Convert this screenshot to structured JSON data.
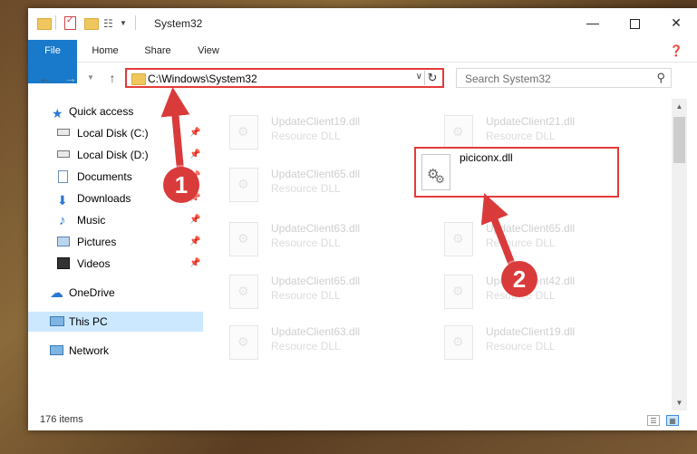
{
  "window": {
    "title": "System32"
  },
  "ribbon": {
    "tabs": [
      "File",
      "Home",
      "Share",
      "View"
    ]
  },
  "address": {
    "path": "C:\\Windows\\System32"
  },
  "search": {
    "placeholder": "Search System32"
  },
  "nav": {
    "quick_access": "Quick access",
    "items": [
      {
        "label": "Local Disk (C:)",
        "icon": "drive-icon",
        "pinned": true
      },
      {
        "label": "Local Disk (D:)",
        "icon": "drive-icon",
        "pinned": true
      },
      {
        "label": "Documents",
        "icon": "documents-icon",
        "pinned": true
      },
      {
        "label": "Downloads",
        "icon": "downloads-icon",
        "pinned": true
      },
      {
        "label": "Music",
        "icon": "music-icon",
        "pinned": true
      },
      {
        "label": "Pictures",
        "icon": "pictures-icon",
        "pinned": true
      },
      {
        "label": "Videos",
        "icon": "videos-icon",
        "pinned": true
      }
    ],
    "onedrive": "OneDrive",
    "this_pc": "This PC",
    "network": "Network"
  },
  "files": {
    "left_column": [
      {
        "name": "UpdateClient19.dll",
        "type": "Resource DLL"
      },
      {
        "name": "UpdateClient65.dll",
        "type": "Resource DLL"
      },
      {
        "name": "UpdateClient63.dll",
        "type": "Resource DLL"
      },
      {
        "name": "UpdateClient65.dll",
        "type": "Resource DLL"
      },
      {
        "name": "UpdateClient63.dll",
        "type": "Resource DLL"
      }
    ],
    "right_column": [
      {
        "name": "UpdateClient21.dll",
        "type": "Resource DLL"
      },
      {
        "name": "UpdateClient65.dll",
        "type": "Resource DLL"
      },
      {
        "name": "UpdateClient42.dll",
        "type": "Resource DLL"
      },
      {
        "name": "UpdateClient19.dll",
        "type": "Resource DLL"
      }
    ],
    "highlighted": {
      "name": "piciconx.dll"
    }
  },
  "status": {
    "item_count": "176 items"
  },
  "annotations": {
    "marker_1": "1",
    "marker_2": "2"
  },
  "colors": {
    "accent": "#1979ca",
    "annotation": "#d93b3b",
    "selection": "#cce8ff"
  }
}
